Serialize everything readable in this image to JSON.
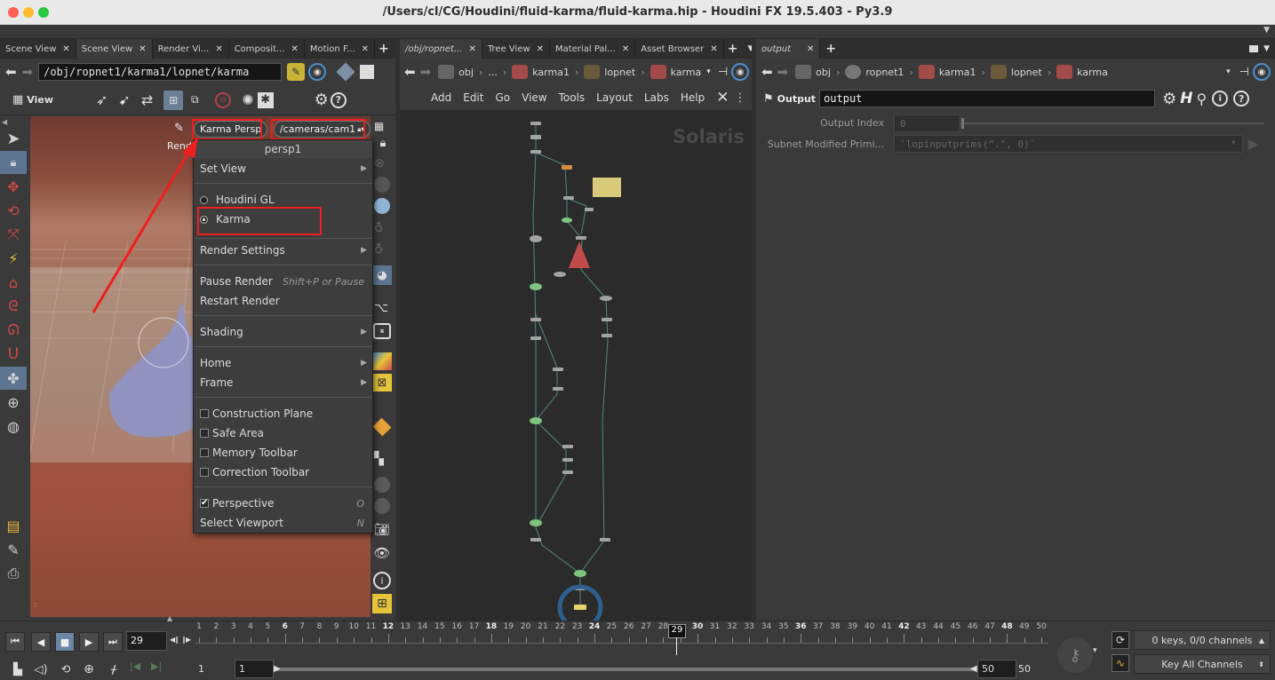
{
  "window": {
    "title": "/Users/cl/CG/Houdini/fluid-karma/fluid-karma.hip - Houdini FX 19.5.403 - Py3.9"
  },
  "left_pane": {
    "tabs": [
      "Scene View",
      "Scene View",
      "Render Vi...",
      "Composit...",
      "Motion F..."
    ],
    "path": "/obj/ropnet1/karma1/lopnet/karma",
    "view_label": "View",
    "render_label": "Rend",
    "renderer_button": "Karma Persp",
    "camera_button": "/cameras/cam1",
    "menu": {
      "header": "persp1",
      "items": {
        "set_view": "Set View",
        "houdini_gl": "Houdini GL",
        "karma": "Karma",
        "render_settings": "Render Settings",
        "pause_render": "Pause Render",
        "pause_shortcut": "Shift+P or Pause",
        "restart_render": "Restart Render",
        "shading": "Shading",
        "home": "Home",
        "frame": "Frame",
        "construction_plane": "Construction Plane",
        "safe_area": "Safe Area",
        "memory_toolbar": "Memory Toolbar",
        "correction_toolbar": "Correction Toolbar",
        "perspective": "Perspective",
        "perspective_shortcut": "O",
        "select_viewport": "Select Viewport",
        "select_viewport_shortcut": "N"
      },
      "selected_renderer": "Karma"
    }
  },
  "middle_pane": {
    "tabs": [
      "/obj/ropnet...",
      "Tree View",
      "Material Pal...",
      "Asset Browser"
    ],
    "crumbs": [
      "obj",
      "...",
      "karma1",
      "lopnet",
      "karma"
    ],
    "menu": [
      "Add",
      "Edit",
      "Go",
      "View",
      "Tools",
      "Layout",
      "Labs",
      "Help"
    ],
    "watermark": "Solaris"
  },
  "right_pane": {
    "tabs": [
      "output"
    ],
    "crumbs": [
      "obj",
      "ropnet1",
      "karma1",
      "lopnet",
      "karma"
    ],
    "node_type": "Output",
    "node_name": "output",
    "params": {
      "output_index_label": "Output Index",
      "output_index_value": "0",
      "subnet_label": "Subnet Modified Primi...",
      "subnet_value": "`lopinputprims(\".\", 0)`"
    }
  },
  "timeline": {
    "current_frame": "29",
    "frame_numbers": [
      "1",
      "2",
      "3",
      "4",
      "5",
      "6",
      "7",
      "8",
      "9",
      "10",
      "11",
      "12",
      "13",
      "14",
      "15",
      "16",
      "17",
      "18",
      "19",
      "20",
      "21",
      "22",
      "23",
      "24",
      "25",
      "26",
      "27",
      "28",
      "29",
      "30",
      "31",
      "32",
      "33",
      "34",
      "35",
      "36",
      "37",
      "38",
      "39",
      "40",
      "41",
      "42",
      "43",
      "44",
      "45",
      "46",
      "47",
      "48",
      "49",
      "50"
    ],
    "range_start": "1",
    "range_start2": "1",
    "range_end": "50",
    "range_end2": "50",
    "keys_label": "0 keys, 0/0 channels",
    "key_all_label": "Key All Channels"
  },
  "colors": {
    "accent_red": "#ee1f1f",
    "panel_bg": "#3a3a3a",
    "network_bg": "#2b2b2b"
  }
}
